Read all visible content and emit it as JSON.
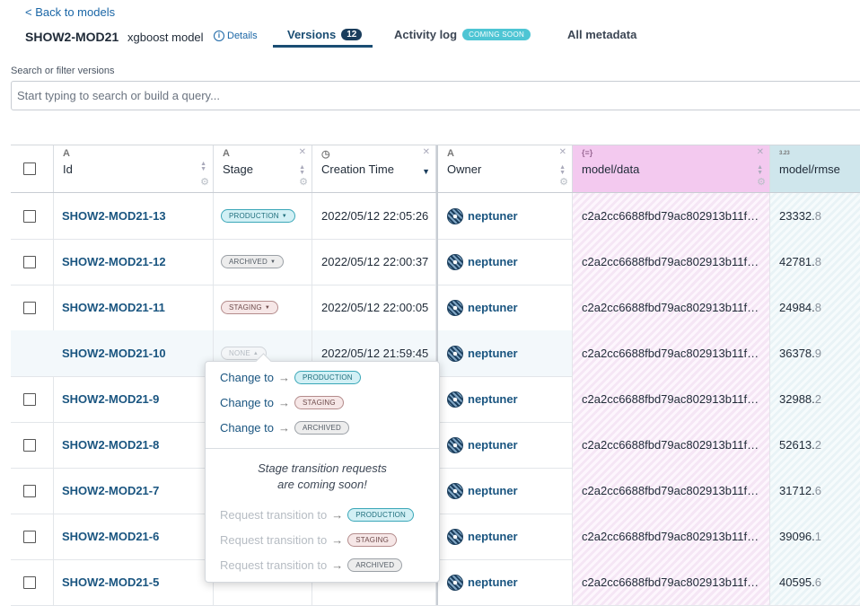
{
  "header": {
    "back_label": "< Back to models",
    "model_name": "SHOW2-MOD21",
    "model_type": "xgboost model",
    "details_label": "Details"
  },
  "tabs": [
    {
      "label": "Versions",
      "badge": "12",
      "active": true
    },
    {
      "label": "Activity log",
      "badge": "COMING SOON"
    },
    {
      "label": "All metadata"
    }
  ],
  "search": {
    "label": "Search or filter versions",
    "placeholder": "Start typing to search or build a query..."
  },
  "columns": {
    "id": "Id",
    "stage": "Stage",
    "creation_time": "Creation Time",
    "owner": "Owner",
    "data": "model/data",
    "rmse": "model/rmse"
  },
  "rows": [
    {
      "id": "SHOW2-MOD21-13",
      "stage": "PRODUCTION",
      "time": "2022/05/12 22:05:26",
      "owner": "neptuner",
      "data": "c2a2cc6688fbd79ac802913b11f…",
      "rmse_main": "23332.",
      "rmse_dec": "8"
    },
    {
      "id": "SHOW2-MOD21-12",
      "stage": "ARCHIVED",
      "time": "2022/05/12 22:00:37",
      "owner": "neptuner",
      "data": "c2a2cc6688fbd79ac802913b11f…",
      "rmse_main": "42781.",
      "rmse_dec": "8"
    },
    {
      "id": "SHOW2-MOD21-11",
      "stage": "STAGING",
      "time": "2022/05/12 22:00:05",
      "owner": "neptuner",
      "data": "c2a2cc6688fbd79ac802913b11f…",
      "rmse_main": "24984.",
      "rmse_dec": "8"
    },
    {
      "id": "SHOW2-MOD21-10",
      "stage": "NONE",
      "time": "2022/05/12 21:59:45",
      "owner": "neptuner",
      "data": "c2a2cc6688fbd79ac802913b11f…",
      "rmse_main": "36378.",
      "rmse_dec": "9"
    },
    {
      "id": "SHOW2-MOD21-9",
      "stage": "",
      "time": "",
      "owner": "neptuner",
      "data": "c2a2cc6688fbd79ac802913b11f…",
      "rmse_main": "32988.",
      "rmse_dec": "2"
    },
    {
      "id": "SHOW2-MOD21-8",
      "stage": "",
      "time": "",
      "owner": "neptuner",
      "data": "c2a2cc6688fbd79ac802913b11f…",
      "rmse_main": "52613.",
      "rmse_dec": "2"
    },
    {
      "id": "SHOW2-MOD21-7",
      "stage": "",
      "time": "",
      "owner": "neptuner",
      "data": "c2a2cc6688fbd79ac802913b11f…",
      "rmse_main": "31712.",
      "rmse_dec": "6"
    },
    {
      "id": "SHOW2-MOD21-6",
      "stage": "",
      "time": "",
      "owner": "neptuner",
      "data": "c2a2cc6688fbd79ac802913b11f…",
      "rmse_main": "39096.",
      "rmse_dec": "1"
    },
    {
      "id": "SHOW2-MOD21-5",
      "stage": "",
      "time": "",
      "owner": "neptuner",
      "data": "c2a2cc6688fbd79ac802913b11f…",
      "rmse_main": "40595.",
      "rmse_dec": "6"
    }
  ],
  "popover": {
    "change_label": "Change to",
    "request_label": "Request transition to",
    "note_line1": "Stage transition requests",
    "note_line2": "are coming soon!",
    "stages": [
      "PRODUCTION",
      "STAGING",
      "ARCHIVED"
    ]
  },
  "colors": {
    "accent": "#1a4d73",
    "production": "#3aa7b8",
    "data_column": "#f3c9ef",
    "rmse_column": "#cfe6ec"
  }
}
